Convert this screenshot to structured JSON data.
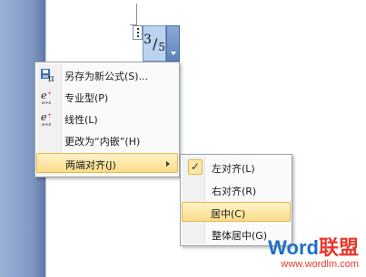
{
  "equation": {
    "numerator": "3",
    "slash": "/",
    "denominator": "5"
  },
  "context_menu": {
    "items": [
      {
        "label": "另存为新公式(S)...",
        "icon": "save-as-new-equation-icon"
      },
      {
        "label": "专业型(P)",
        "icon": "professional-equation-icon"
      },
      {
        "label": "线性(L)",
        "icon": "linear-equation-icon"
      },
      {
        "label": "更改为“内嵌”(H)",
        "icon": ""
      },
      {
        "label": "两端对齐(J)",
        "icon": "",
        "highlighted": true,
        "has_submenu": true
      }
    ]
  },
  "justify_submenu": {
    "items": [
      {
        "label": "左对齐(L)",
        "checked": true
      },
      {
        "label": "右对齐(R)",
        "checked": false
      },
      {
        "label": "居中(C)",
        "checked": false,
        "highlighted": true
      },
      {
        "label": "整体居中(G)",
        "checked": false
      }
    ],
    "check_glyph": "✓"
  },
  "watermark": {
    "brand_part1": "Word",
    "brand_part2": "联盟",
    "url": "www.wordlm.com"
  },
  "colors": {
    "highlight_top": "#fef3c7",
    "highlight_bottom": "#fbdc8a",
    "highlight_border": "#e3b84a",
    "equation_selection": "#bcd3f0",
    "watermark_blue": "#1f6fc7",
    "watermark_red": "#e8392a"
  }
}
